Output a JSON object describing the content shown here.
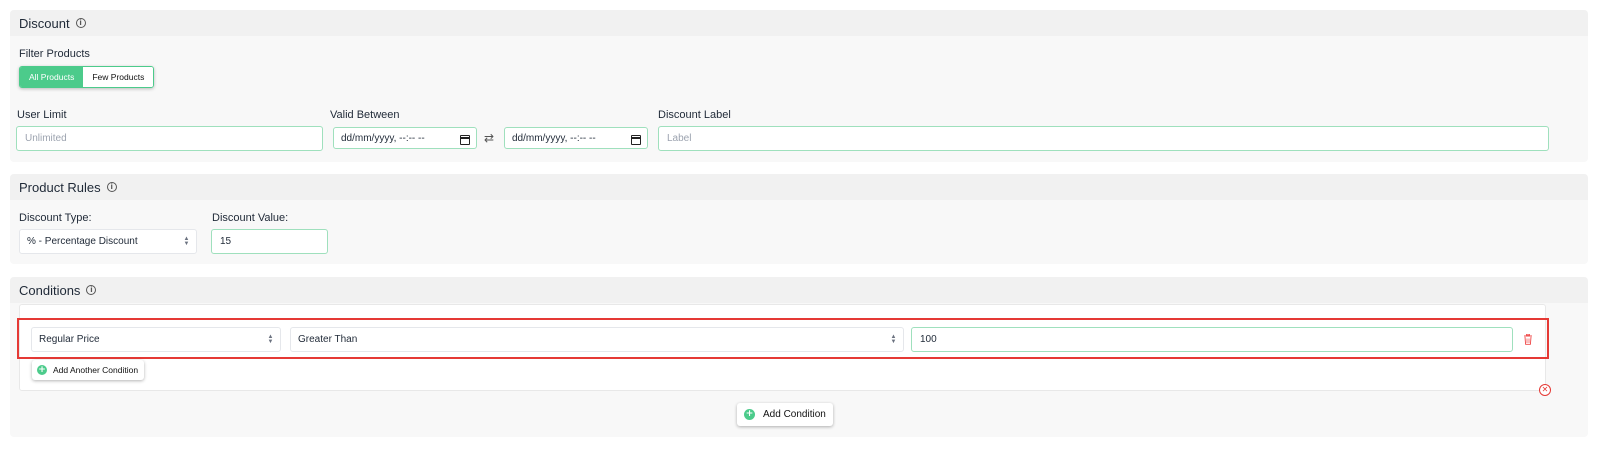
{
  "discount": {
    "title": "Discount",
    "filter_label": "Filter Products",
    "filter_options": [
      "All Products",
      "Few Products"
    ],
    "user_limit": {
      "label": "User Limit",
      "placeholder": "Unlimited",
      "value": ""
    },
    "valid_between": {
      "label": "Valid Between",
      "start": "dd/mm/yyyy, --:-- --",
      "end": "dd/mm/yyyy, --:-- --"
    },
    "discount_label": {
      "label": "Discount Label",
      "placeholder": "Label",
      "value": ""
    }
  },
  "product_rules": {
    "title": "Product Rules",
    "discount_type_label": "Discount Type:",
    "discount_type_value": "% - Percentage Discount",
    "discount_value_label": "Discount Value:",
    "discount_value": "15"
  },
  "conditions": {
    "title": "Conditions",
    "rows": [
      {
        "field": "Regular Price",
        "operator": "Greater Than",
        "value": "100"
      }
    ],
    "add_another_label": "Add Another Condition",
    "add_condition_label": "Add Condition"
  },
  "colors": {
    "accent": "#4ccb8b",
    "highlight": "#e53935",
    "danger": "#e53935"
  },
  "icons": [
    "info-icon",
    "calendar-icon",
    "swap-arrows-icon",
    "plus-circle-icon",
    "trash-icon",
    "close-circle-icon",
    "select-arrows-icon"
  ]
}
